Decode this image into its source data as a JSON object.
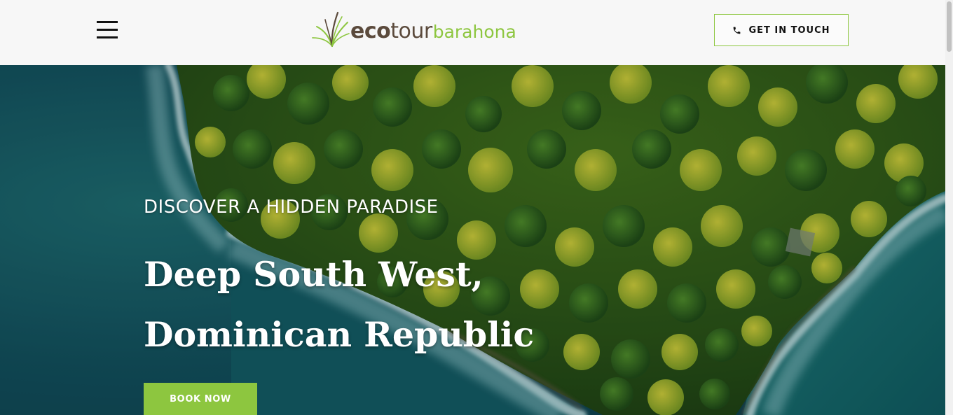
{
  "header": {
    "logo": {
      "part_eco": "eco",
      "part_tour": "tour",
      "part_place": "barahona",
      "brown": "#5b4a3c",
      "green": "#8dc63f"
    },
    "menu_icon": "hamburger-menu-icon",
    "contact_button": {
      "icon": "phone-icon",
      "label": "GET IN TOUCH"
    }
  },
  "hero": {
    "eyebrow": "DISCOVER A HIDDEN PARADISE",
    "title_line1": "Deep South West,",
    "title_line2": "Dominican Republic",
    "book_button": "BOOK NOW",
    "background": "aerial-coastline-forest-image"
  },
  "colors": {
    "accent": "#8dc63f",
    "header_bg": "#f7f7f7",
    "ocean": "#11505a"
  }
}
